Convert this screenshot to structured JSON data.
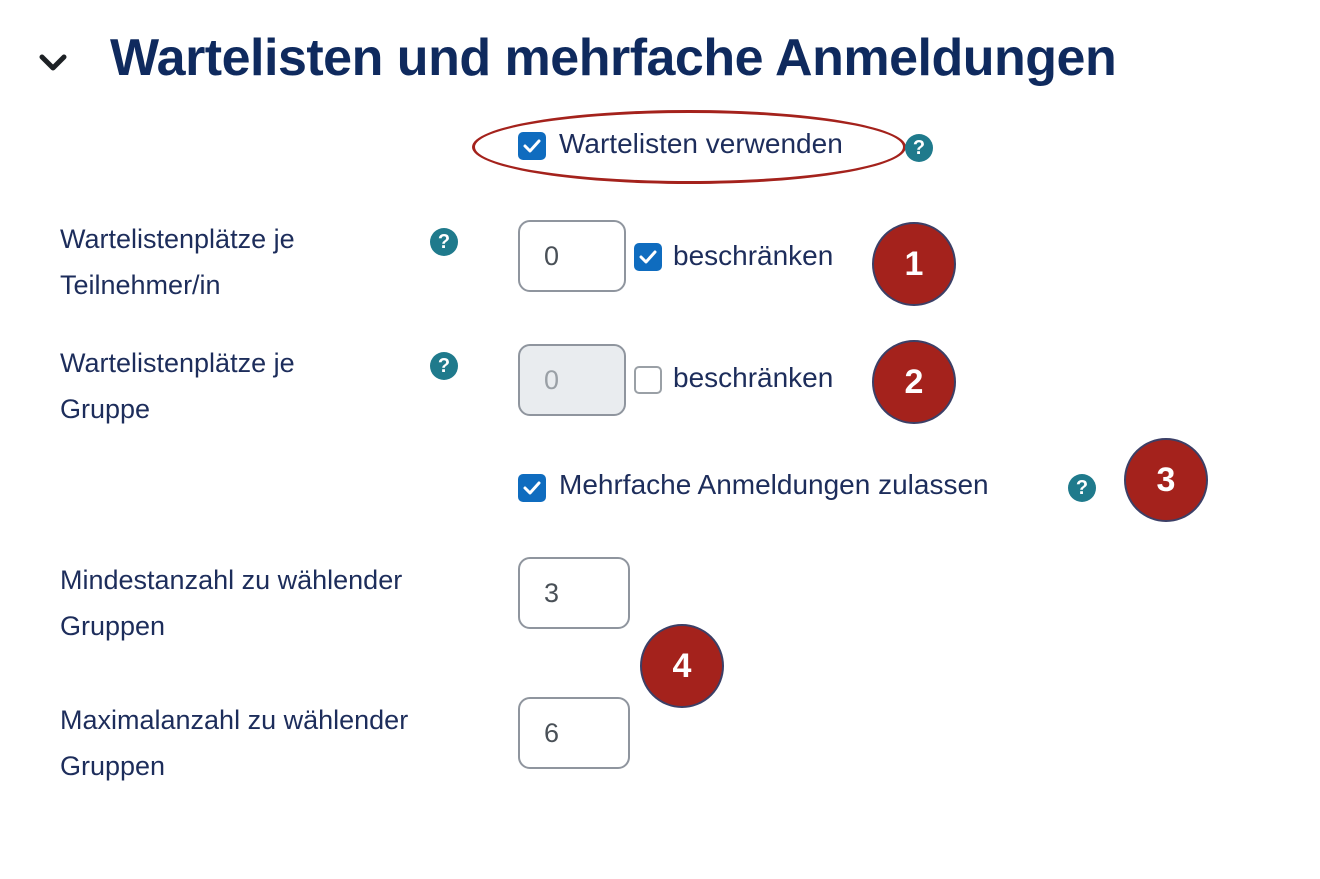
{
  "section": {
    "title": "Wartelisten und mehrfache Anmeldungen",
    "collapse_icon": "chevron-down-icon"
  },
  "use_waitlists": {
    "label": "Wartelisten verwenden",
    "checked": true
  },
  "waitlist_per_participant": {
    "label_line1": "Wartelistenplätze je",
    "label_line2": "Teilnehmer/in",
    "value": "0",
    "limit_label": "beschränken",
    "limit_checked": true,
    "badge": "1"
  },
  "waitlist_per_group": {
    "label_line1": "Wartelistenplätze je",
    "label_line2": "Gruppe",
    "value": "0",
    "limit_label": "beschränken",
    "limit_checked": false,
    "disabled": true,
    "badge": "2"
  },
  "multiple_registrations": {
    "label": "Mehrfache Anmeldungen zulassen",
    "checked": true,
    "badge": "3"
  },
  "min_groups": {
    "label_line1": "Mindestanzahl zu wählender",
    "label_line2": "Gruppen",
    "value": "3"
  },
  "max_groups": {
    "label_line1": "Maximalanzahl zu wählender",
    "label_line2": "Gruppen",
    "value": "6"
  },
  "min_max_badge": "4",
  "help_glyph": "?",
  "colors": {
    "title": "#0f2a5e",
    "label": "#1d2d5b",
    "checkbox": "#0f6cbf",
    "help": "#1f7a8c",
    "badge": "#a4221c"
  }
}
